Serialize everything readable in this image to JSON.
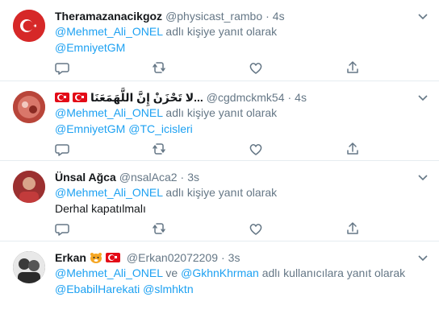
{
  "tweets": [
    {
      "name": "Theramazanacikgoz",
      "handle": "@physicast_rambo",
      "time": "4s",
      "line1_links": "@Mehmet_Ali_ONEL",
      "line1_text": " adlı kişiye yanıt olarak",
      "line2": "@EmniyetGM",
      "avatar_color": "#d62828"
    },
    {
      "name": "لا تَحْزَنْ إِنَّ اللَّهَمَعَنَا...",
      "handle": "@cgdmckmk54",
      "time": "4s",
      "line1_links": "@Mehmet_Ali_ONEL",
      "line1_text": " adlı kişiye yanıt olarak",
      "line2_a": "@EmniyetGM",
      "line2_b": "@TC_icisleri",
      "avatar_color": "#c94a3a"
    },
    {
      "name": "Ünsal Ağca",
      "handle": "@nsalAca2",
      "time": "3s",
      "line1_links": "@Mehmet_Ali_ONEL",
      "line1_text": " adlı kişiye yanıt olarak",
      "body": "Derhal kapatılmalı",
      "avatar_color": "#a83232"
    },
    {
      "name": "Erkan",
      "handle": "@Erkan02072209",
      "time": "3s",
      "line1_link_a": "@Mehmet_Ali_ONEL",
      "line1_ve": " ve ",
      "line1_link_b": "@GkhnKhrman",
      "line1_text": " adlı kullanıcılara yanıt olarak",
      "line2_a": "@EbabilHarekati",
      "line2_b": "@slmhktn",
      "avatar_color": "#444444"
    }
  ],
  "separator": " · ",
  "icons": [
    "chevron-down-icon",
    "reply-icon",
    "retweet-icon",
    "like-icon",
    "share-icon",
    "turkey-flag-icon",
    "tiger-icon"
  ],
  "colors": {
    "link": "#1da1f2",
    "muted": "#657786",
    "text": "#14171a",
    "border": "#e6ecf0"
  }
}
